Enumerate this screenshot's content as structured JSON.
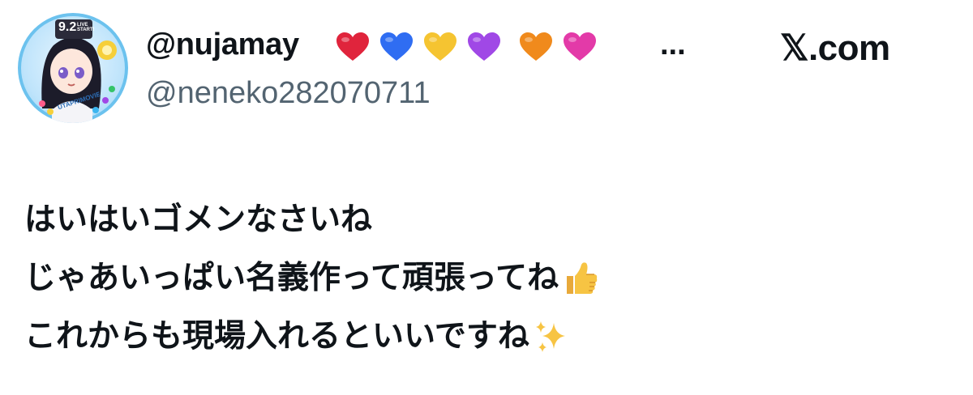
{
  "tweet": {
    "display_name": "@nujamay",
    "display_name_emojis": [
      "red-heart",
      "blue-heart",
      "yellow-heart",
      "purple-heart",
      "orange-heart",
      "pink-heart"
    ],
    "display_name_truncation": "...",
    "username": "@neneko282070711",
    "brand": "𝕏.com",
    "avatar_badge_text": "9.2",
    "avatar_badge_subtext": "LIVE START!",
    "avatar_ring_text": "UTAPRIMOVIE",
    "lines": [
      {
        "text": "はいはいゴメンなさいね",
        "emoji": ""
      },
      {
        "text": "じゃあいっぱい名義作って頑張ってね",
        "emoji": "thumbs-up"
      },
      {
        "text": "これからも現場入れるといいですね",
        "emoji": "sparkles"
      }
    ]
  },
  "colors": {
    "text_primary": "#0f1419",
    "text_secondary": "#536471",
    "red_heart": "#e0243c",
    "blue_heart": "#2f6df2",
    "yellow_heart": "#f5c431",
    "purple_heart": "#a048e6",
    "orange_heart": "#f08a1c",
    "pink_heart": "#e33aa8"
  }
}
